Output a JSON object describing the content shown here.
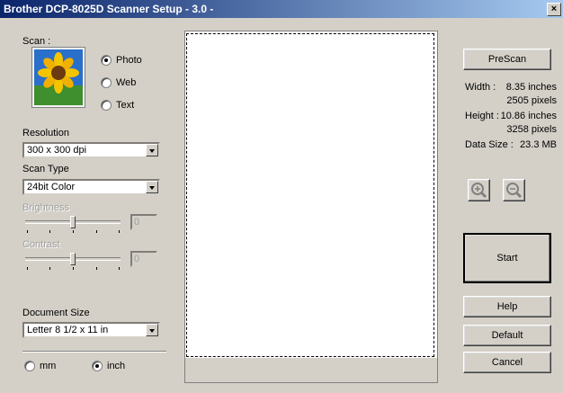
{
  "window": {
    "title": "Brother DCP-8025D Scanner Setup - 3.0 -",
    "close_glyph": "×"
  },
  "scan": {
    "label": "Scan :",
    "options": [
      {
        "label": "Photo",
        "checked": true
      },
      {
        "label": "Web",
        "checked": false
      },
      {
        "label": "Text",
        "checked": false
      }
    ]
  },
  "resolution": {
    "label": "Resolution",
    "value": "300 x 300 dpi"
  },
  "scan_type": {
    "label": "Scan Type",
    "value": "24bit Color"
  },
  "brightness": {
    "label": "Brightness",
    "value": "0"
  },
  "contrast": {
    "label": "Contrast",
    "value": "0"
  },
  "document_size": {
    "label": "Document Size",
    "value": "Letter 8 1/2 x 11 in"
  },
  "units": [
    {
      "label": "mm",
      "checked": false
    },
    {
      "label": "inch",
      "checked": true
    }
  ],
  "buttons": {
    "prescan": "PreScan",
    "start": "Start",
    "help": "Help",
    "default": "Default",
    "cancel": "Cancel"
  },
  "info": {
    "width_label": "Width :",
    "width_inches": "8.35 inches",
    "width_pixels": "2505 pixels",
    "height_label": "Height :",
    "height_inches": "10.86 inches",
    "height_pixels": "3258 pixels",
    "data_size_label": "Data Size :",
    "data_size": "23.3 MB"
  },
  "icons": {
    "zoom_in": "zoom-in-icon",
    "zoom_out": "zoom-out-icon",
    "photo_thumbnail": "sunflower-photo"
  }
}
